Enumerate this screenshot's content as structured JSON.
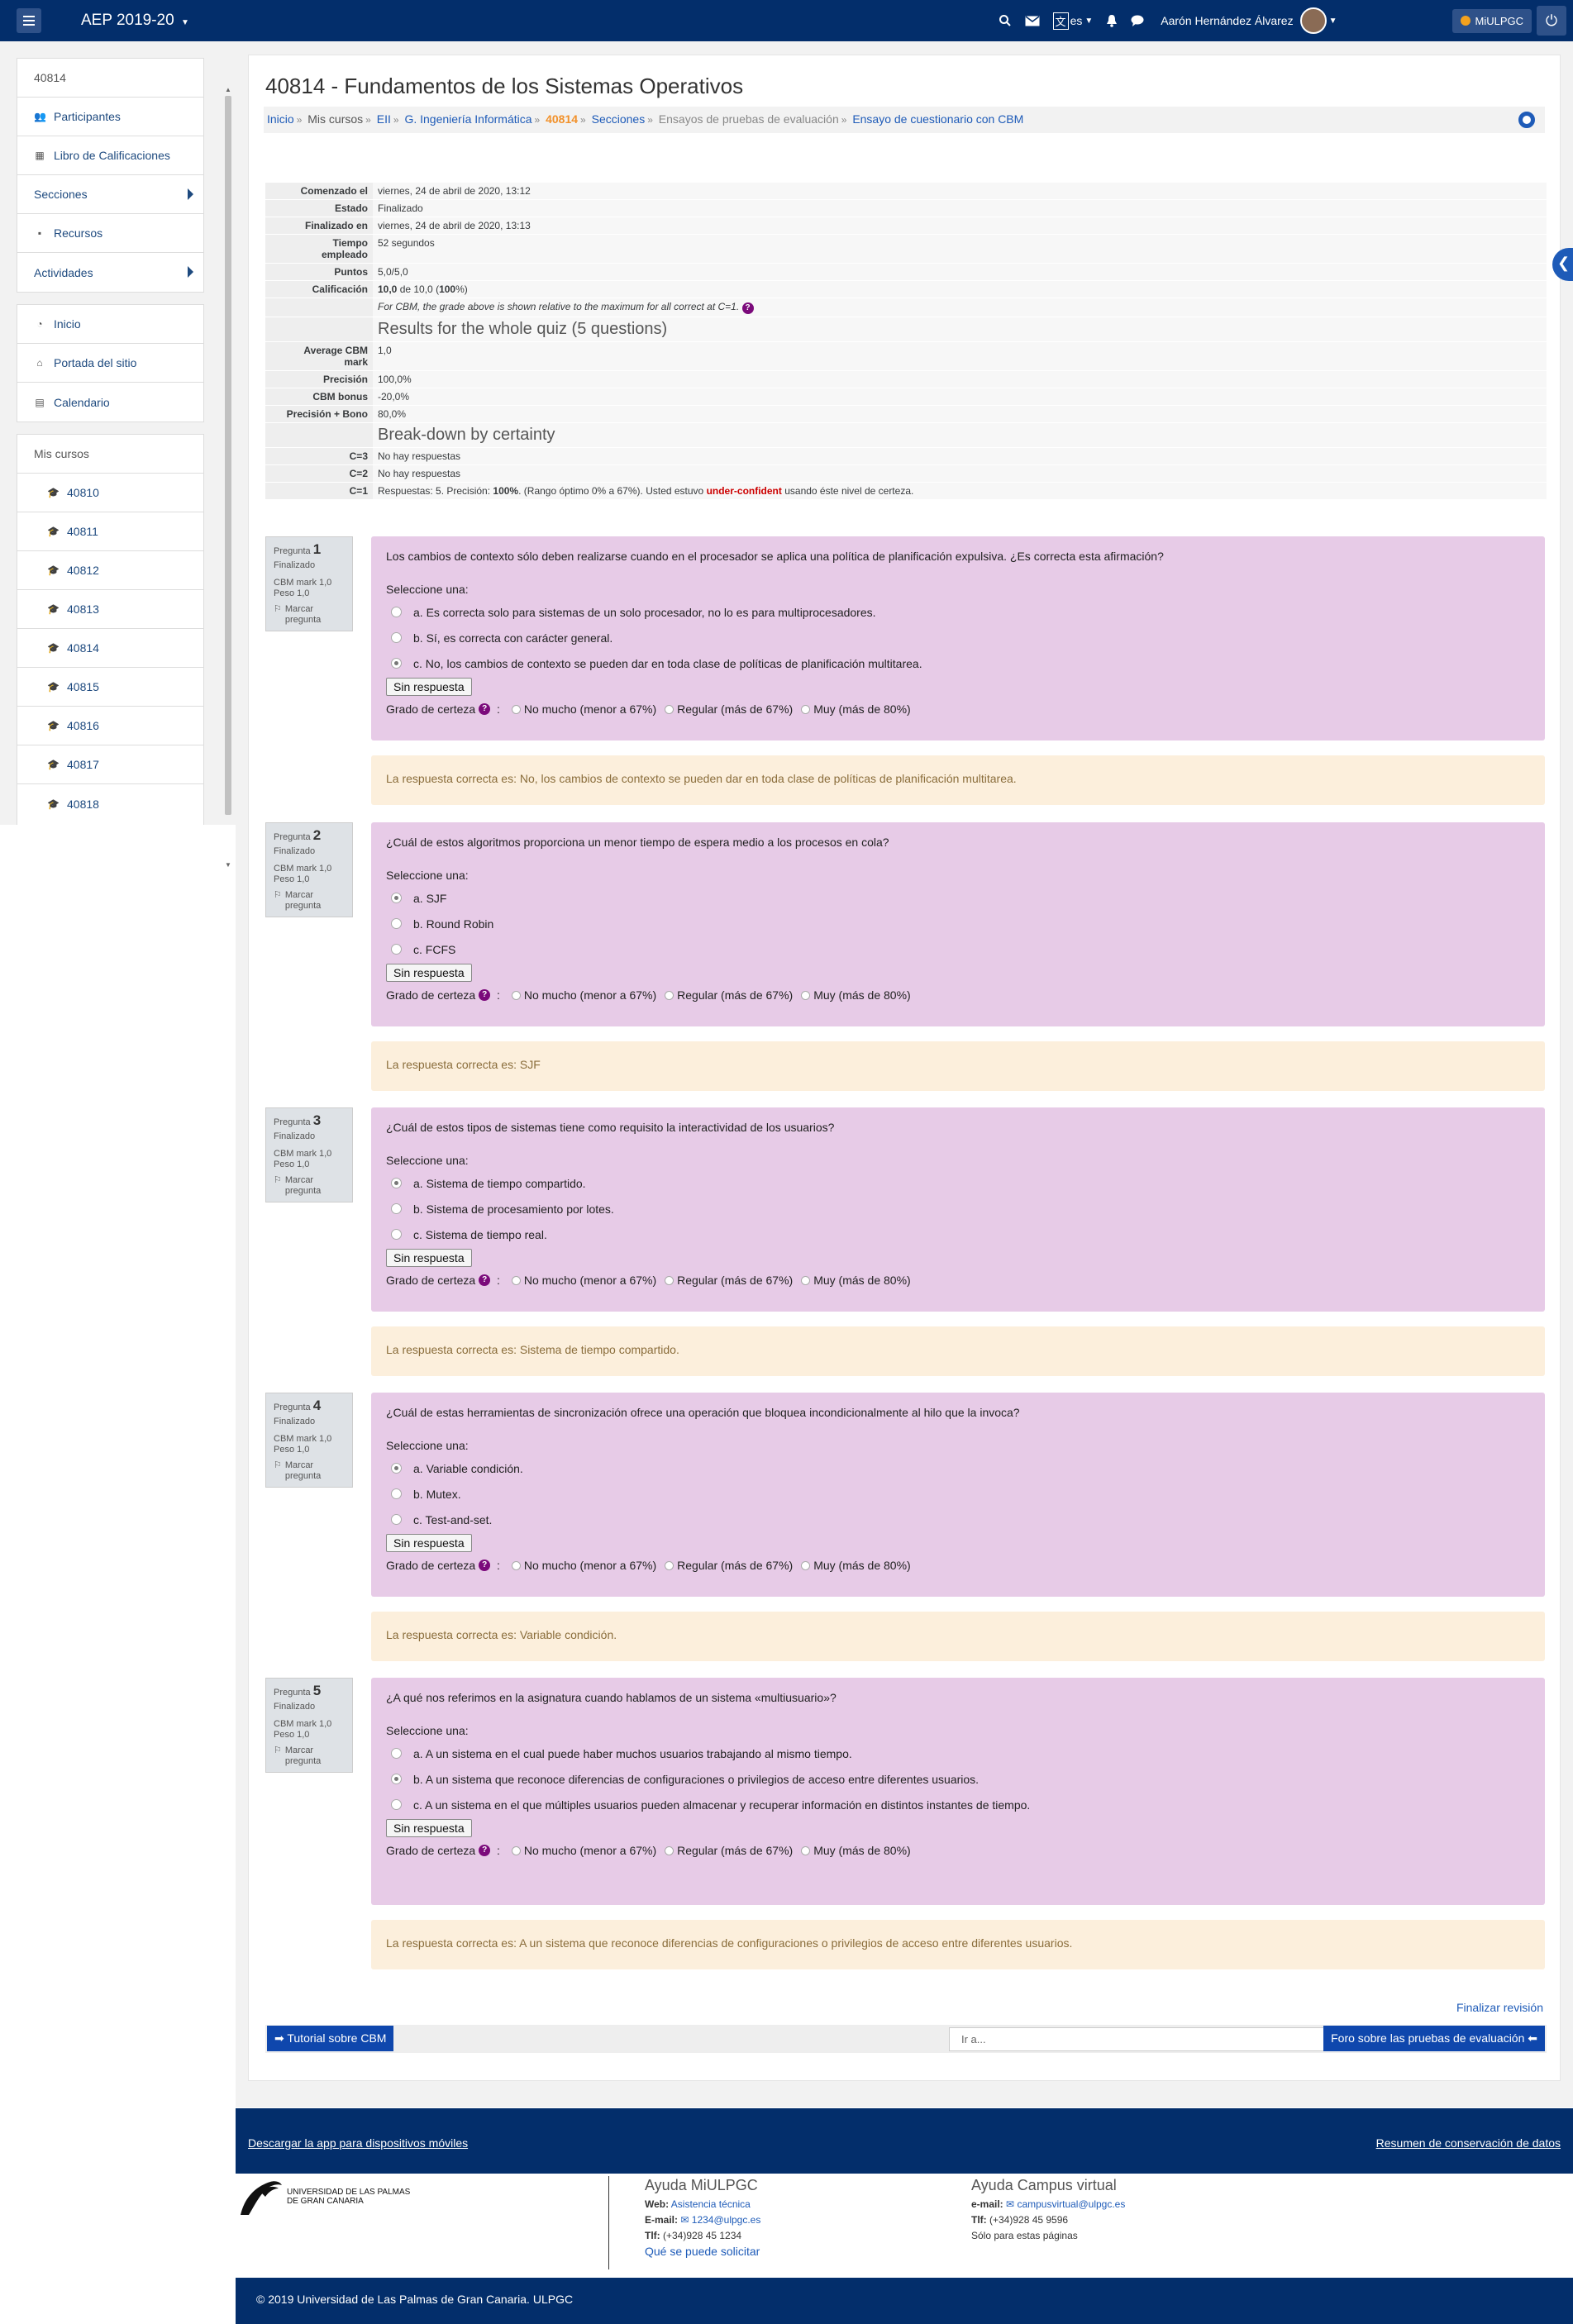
{
  "topbar": {
    "brand": "AEP 2019-20",
    "lang": "es",
    "user": "Aarón Hernández Álvarez",
    "miulpgc": "MiULPGC"
  },
  "drawer": {
    "course_items": [
      {
        "label": "40814",
        "icon": ""
      },
      {
        "label": "Participantes",
        "icon": "users-icon"
      },
      {
        "label": "Libro de Calificaciones",
        "icon": "table-icon"
      },
      {
        "label": "Secciones",
        "icon": ""
      },
      {
        "label": "Recursos",
        "icon": "archive-icon"
      },
      {
        "label": "Actividades",
        "icon": ""
      }
    ],
    "site_items": [
      {
        "label": "Inicio",
        "icon": "dashboard-icon"
      },
      {
        "label": "Portada del sitio",
        "icon": "home-icon"
      },
      {
        "label": "Calendario",
        "icon": "calendar-icon"
      }
    ],
    "my_courses_title": "Mis cursos",
    "courses": [
      "40810",
      "40811",
      "40812",
      "40813",
      "40814",
      "40815",
      "40816",
      "40817",
      "40818"
    ]
  },
  "header": {
    "title": "40814 - Fundamentos de los Sistemas Operativos",
    "breadcrumb": [
      "Inicio",
      "Mis cursos",
      "EII",
      "G. Ingeniería Informática",
      "40814",
      "Secciones",
      "Ensayos de pruebas de evaluación",
      "Ensayo de cuestionario con CBM"
    ]
  },
  "summary": {
    "comenzado_label": "Comenzado el",
    "comenzado": "viernes, 24 de abril de 2020, 13:12",
    "estado_label": "Estado",
    "estado": "Finalizado",
    "finalizado_label": "Finalizado en",
    "finalizado": "viernes, 24 de abril de 2020, 13:13",
    "tiempo_label": "Tiempo empleado",
    "tiempo": "52 segundos",
    "puntos_label": "Puntos",
    "puntos": "5,0/5,0",
    "calificacion_label": "Calificación",
    "calif_bold": "10,0",
    "calif_mid": " de 10,0 (",
    "calif_pct": "100",
    "calif_end": "%)",
    "cbm_note": "For CBM, the grade above is shown relative to the maximum for all correct at C=1.",
    "results_title": "Results for the whole quiz (5 questions)",
    "avg_label": "Average CBM mark",
    "avg": "1,0",
    "precision_label": "Precisión",
    "precision": "100,0%",
    "bonus_label": "CBM bonus",
    "bonus": "-20,0%",
    "prec_bono_label": "Precisión + Bono",
    "prec_bono": "80,0%",
    "breakdown_title": "Break-down by certainty",
    "c3_label": "C=3",
    "c3": "No hay respuestas",
    "c2_label": "C=2",
    "c2": "No hay respuestas",
    "c1_label": "C=1",
    "c1_a": "Respuestas: 5. Precisión: ",
    "c1_b": "100%",
    "c1_c": ". (Rango óptimo 0% a 67%). Usted estuvo ",
    "c1_d": "under-confident",
    "c1_e": " usando éste nivel de certeza."
  },
  "qinfo": {
    "pregunta": "Pregunta",
    "estado": "Finalizado",
    "cbm": "CBM mark 1,0",
    "peso": "Peso 1,0",
    "marcar": "Marcar pregunta"
  },
  "common": {
    "seleccione": "Seleccione una:",
    "sin_respuesta": "Sin respuesta",
    "grado": "Grado de certeza",
    "g1": "No mucho (menor a 67%)",
    "g2": "Regular (más de 67%)",
    "g3": "Muy (más de 80%)"
  },
  "questions": [
    {
      "num": "1",
      "text": "Los cambios de contexto sólo deben realizarse cuando en el procesador se aplica una política de planificación expulsiva. ¿Es correcta esta afirmación?",
      "options": [
        "a. Es correcta solo para sistemas de un solo procesador, no lo es para multiprocesadores.",
        "b. Sí, es correcta con carácter general.",
        "c. No, los cambios de contexto se pueden dar en toda clase de políticas de planificación multitarea."
      ],
      "selected": 2,
      "answer": "La respuesta correcta es: No, los cambios de contexto se pueden dar en toda clase de políticas de planificación multitarea."
    },
    {
      "num": "2",
      "text": "¿Cuál de estos algoritmos proporciona un menor tiempo de espera medio a los procesos en cola?",
      "options": [
        "a. SJF",
        "b. Round Robin",
        "c. FCFS"
      ],
      "selected": 0,
      "answer": "La respuesta correcta es: SJF"
    },
    {
      "num": "3",
      "text": "¿Cuál de estos tipos de sistemas tiene como requisito la interactividad de los usuarios?",
      "options": [
        "a. Sistema de tiempo compartido.",
        "b. Sistema de procesamiento por lotes.",
        "c. Sistema de tiempo real."
      ],
      "selected": 0,
      "answer": "La respuesta correcta es: Sistema de tiempo compartido."
    },
    {
      "num": "4",
      "text": "¿Cuál de estas herramientas de sincronización ofrece una operación que bloquea incondicionalmente al hilo que la invoca?",
      "options": [
        "a. Variable condición.",
        "b. Mutex.",
        "c. Test-and-set."
      ],
      "selected": 0,
      "answer": "La respuesta correcta es: Variable condición."
    },
    {
      "num": "5",
      "text": "¿A qué nos referimos en la asignatura cuando hablamos de un sistema «multiusuario»?",
      "options": [
        "a. A un sistema en el cual puede haber muchos usuarios trabajando al mismo tiempo.",
        "b. A un sistema que reconoce diferencias de configuraciones o privilegios de acceso entre diferentes usuarios.",
        "c. A un sistema en el que múltiples usuarios pueden almacenar y recuperar información en distintos instantes de tiempo."
      ],
      "selected": 1,
      "answer": "La respuesta correcta es: A un sistema que reconoce diferencias de configuraciones o privilegios de acceso entre diferentes usuarios."
    }
  ],
  "nav": {
    "finalizar": "Finalizar revisión",
    "prev": "➡ Tutorial sobre CBM",
    "goto": "Ir a...",
    "next": "Foro sobre las pruebas de evaluación ⬅"
  },
  "footer": {
    "app_link": "Descargar la app para dispositivos móviles",
    "data_link": "Resumen de conservación de datos",
    "logo_line1": "UNIVERSIDAD DE LAS PALMAS",
    "logo_line2": "DE GRAN CANARIA",
    "ayuda1_title": "Ayuda MiULPGC",
    "web_label": "Web:",
    "web": "Asistencia técnica",
    "email_label": "E-mail:",
    "email1": "1234@ulpgc.es",
    "tlf_label": "Tlf:",
    "tlf1": "(+34)928 45 1234",
    "solicitar": "Qué se puede solicitar",
    "ayuda2_title": "Ayuda Campus virtual",
    "email2_label": "e-mail:",
    "email2": "campusvirtual@ulpgc.es",
    "tlf2_label": "Tlf:",
    "tlf2": "(+34)928 45 9596",
    "solo": "Sólo para estas páginas",
    "copyright": "© 2019 Universidad de Las Palmas de Gran Canaria. ULPGC"
  }
}
